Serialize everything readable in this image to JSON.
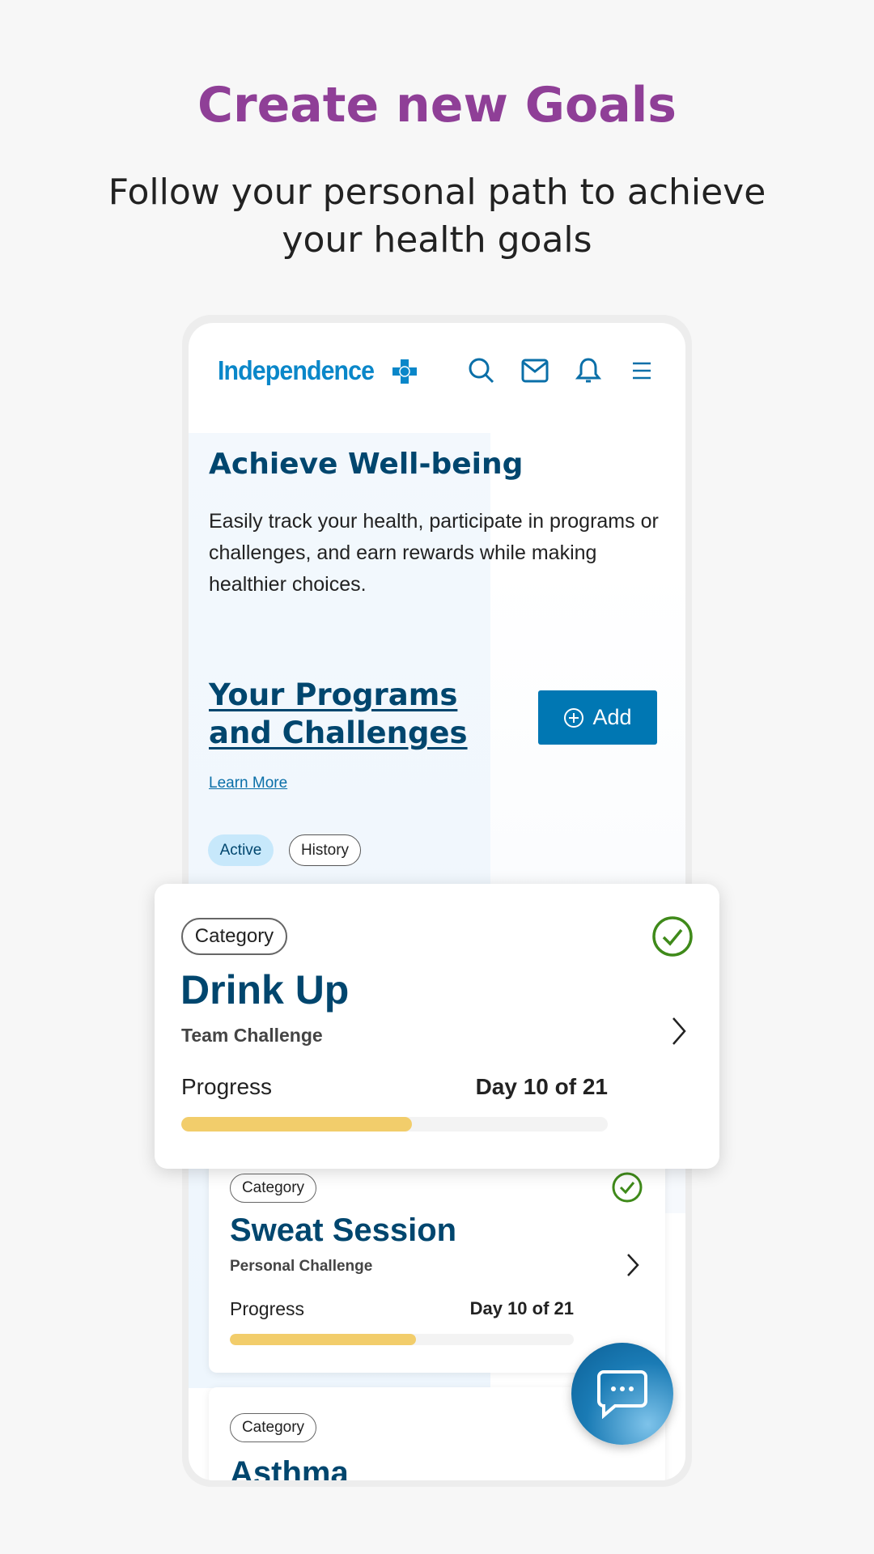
{
  "title": "Create new Goals",
  "subtitle": "Follow your personal path to achieve your health goals",
  "header": {
    "logo": "Independence",
    "icons": [
      "search-icon",
      "mail-icon",
      "bell-icon",
      "menu-icon"
    ]
  },
  "intro": {
    "heading": "Achieve Well-being",
    "body": "Easily track your health, participate in programs or challenges, and earn rewards while making healthier choices."
  },
  "programs": {
    "heading": "Your Programs and Challenges",
    "add_label": "Add",
    "learn_more": "Learn More",
    "tabs": [
      {
        "label": "Active",
        "selected": true
      },
      {
        "label": "History",
        "selected": false
      }
    ]
  },
  "cards": [
    {
      "category": "Category",
      "title": "Drink Up",
      "subtitle": "Team Challenge",
      "progress_label": "Progress",
      "progress_text": "Day 10 of 21",
      "progress_fill": 0.54,
      "completed": true
    },
    {
      "category": "Category",
      "title": "Sweat Session",
      "subtitle": "Personal Challenge",
      "progress_label": "Progress",
      "progress_text": "Day 10 of 21",
      "progress_fill": 0.54,
      "completed": true
    },
    {
      "category": "Category",
      "title": "Asthma"
    }
  ],
  "colors": {
    "title": "#8f3f97",
    "brand": "#0a87c9",
    "heading": "#00466e",
    "button": "#0077b3",
    "progress": "#f2cd6b",
    "check": "#3f8a1a"
  }
}
